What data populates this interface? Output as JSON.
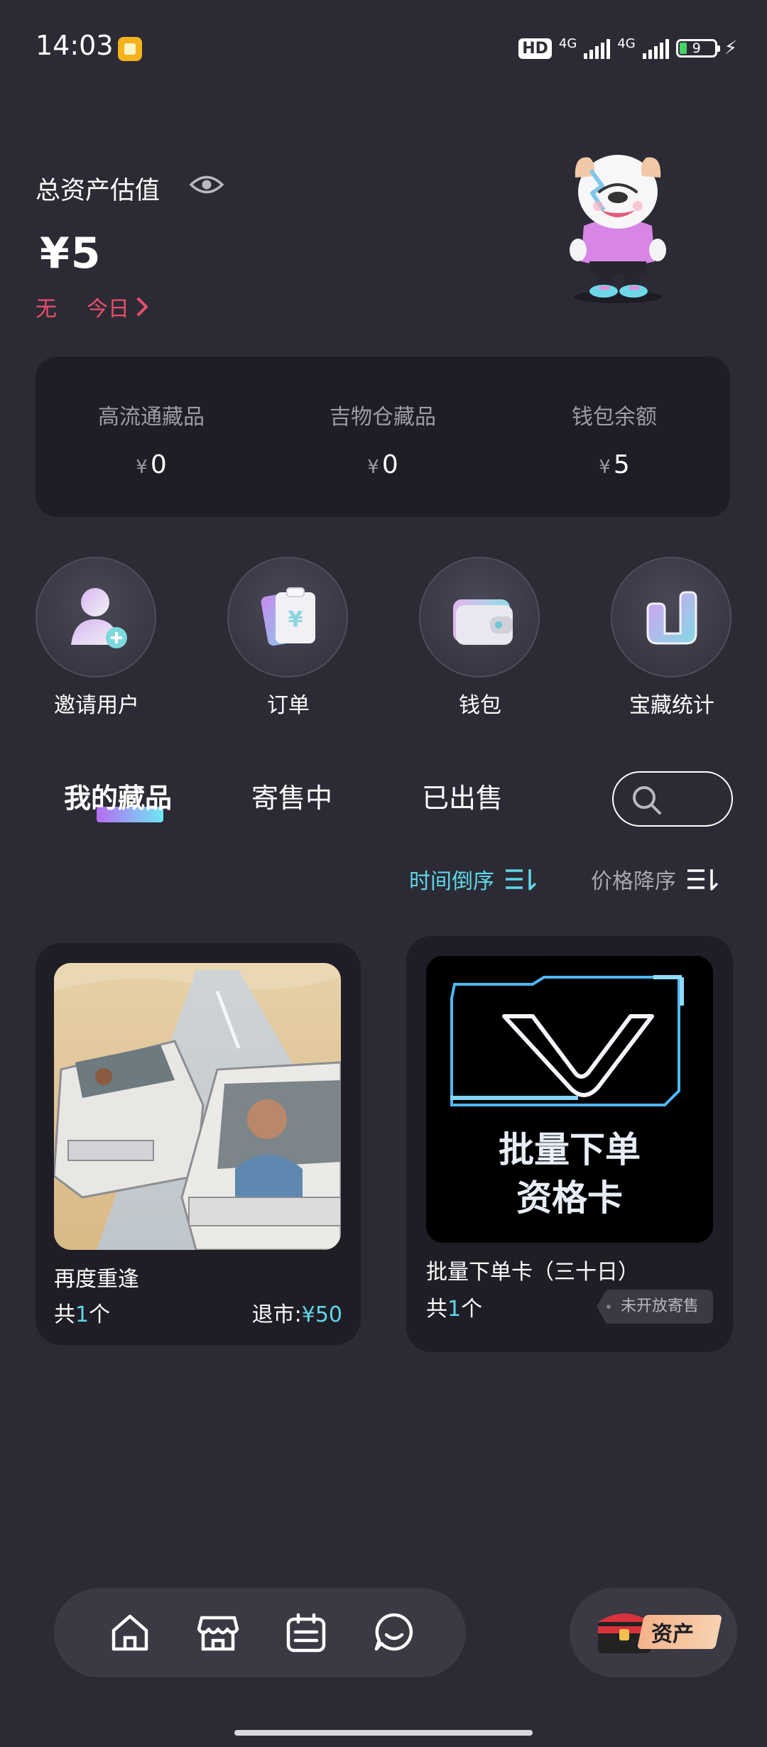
{
  "status_bar": {
    "time": "14:03",
    "hd": "HD",
    "net1": "4G",
    "net2": "4G",
    "battery": "9"
  },
  "asset": {
    "label": "总资产估值",
    "amount": "¥5",
    "change": "无",
    "today": "今日"
  },
  "summary": [
    {
      "label": "高流通藏品",
      "currency": "¥",
      "value": "0"
    },
    {
      "label": "吉物仓藏品",
      "currency": "¥",
      "value": "0"
    },
    {
      "label": "钱包余额",
      "currency": "¥",
      "value": "5"
    }
  ],
  "actions": [
    {
      "label": "邀请用户",
      "icon": "invite-user-icon"
    },
    {
      "label": "订单",
      "icon": "order-icon"
    },
    {
      "label": "钱包",
      "icon": "wallet-icon"
    },
    {
      "label": "宝藏统计",
      "icon": "treasure-stats-icon"
    }
  ],
  "tabs": [
    "我的藏品",
    "寄售中",
    "已出售"
  ],
  "sort": {
    "time": "时间倒序",
    "price": "价格降序"
  },
  "items": [
    {
      "title": "再度重逢",
      "count_prefix": "共",
      "count": "1",
      "count_suffix": "个",
      "refund_label": "退市:",
      "refund_price": "¥50"
    },
    {
      "title": "批量下单卡（三十日）",
      "image_text_1": "批量下单",
      "image_text_2": "资格卡",
      "count_prefix": "共",
      "count": "1",
      "count_suffix": "个",
      "status": "未开放寄售"
    }
  ],
  "nav": {
    "asset_label": "资产"
  },
  "colors": {
    "background": "#2c2b35",
    "card": "#1f1e26",
    "accent_cyan": "#5fd6e8",
    "accent_red": "#e94e6c"
  }
}
